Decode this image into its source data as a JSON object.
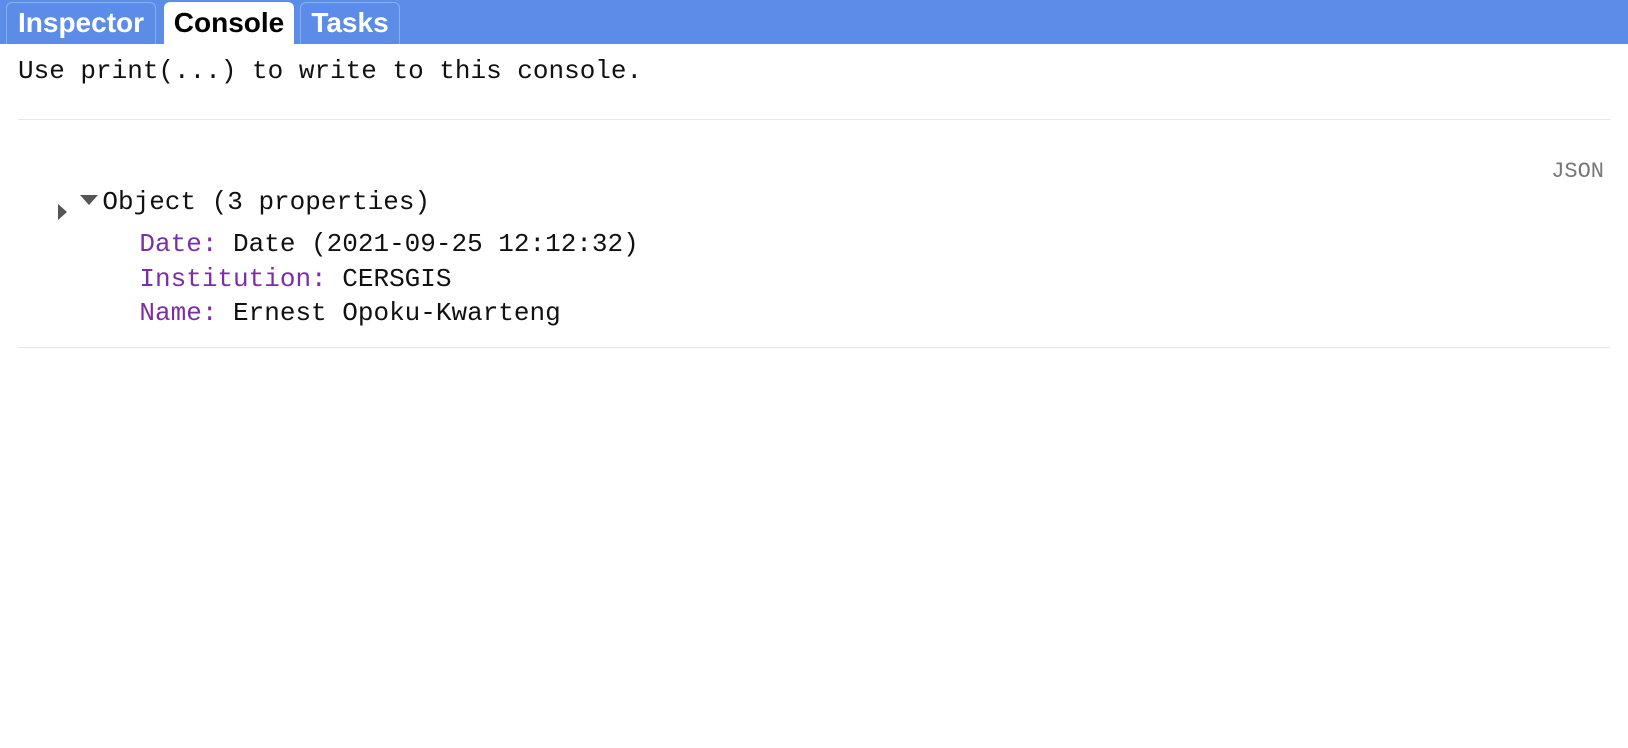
{
  "tabs": [
    {
      "label": "Inspector",
      "active": false
    },
    {
      "label": "Console",
      "active": true
    },
    {
      "label": "Tasks",
      "active": false
    }
  ],
  "console": {
    "hint": "Use print(...) to write to this console.",
    "object": {
      "summary": "Object (3 properties)",
      "json_label": "JSON",
      "properties": [
        {
          "key": "Date:",
          "value": "Date (2021-09-25 12:12:32)",
          "expandable": true
        },
        {
          "key": "Institution:",
          "value": "CERSGIS",
          "expandable": false
        },
        {
          "key": "Name:",
          "value": "Ernest Opoku-Kwarteng",
          "expandable": false
        }
      ]
    }
  },
  "colors": {
    "tab_bar": "#5b8de8",
    "property_key": "#7b2fa6",
    "json_link": "#777777"
  },
  "icons": {
    "object_toggle": "triangle-down-icon",
    "date_toggle": "triangle-right-icon"
  }
}
